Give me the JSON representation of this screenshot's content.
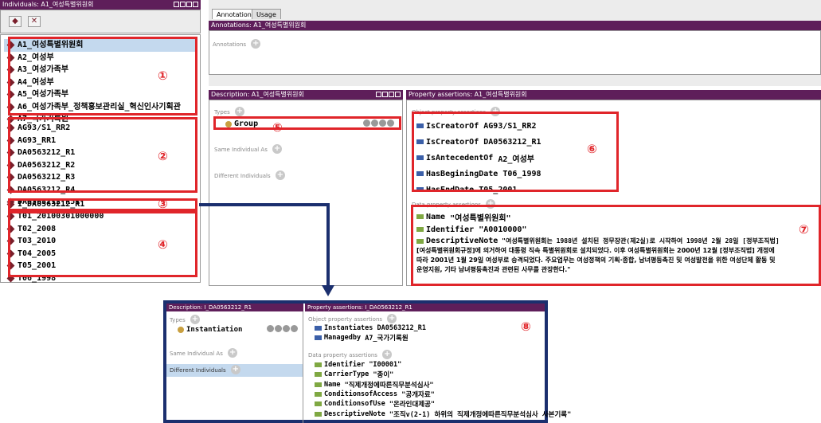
{
  "individuals_panel": {
    "title": "Individuals: A1_여성특별위원회",
    "items_group1": [
      "A1_여성특별위원회",
      "A2_여성부",
      "A3_여성가족부",
      "A4_여성부",
      "A5_여성가족부",
      "A6_여성가족부_정책홍보관리실_혁신인사기획관",
      "A7_국가기록원"
    ],
    "items_group2": [
      "AG93/S1_RR2",
      "AG93_RR1",
      "DA0563212_R1",
      "DA0563212_R2",
      "DA0563212_R3",
      "DA0563212_R4",
      "DA0563212_R51"
    ],
    "items_group3": [
      "I_DA0563212_R1"
    ],
    "items_group4": [
      "T01_20100301000000",
      "T02_2008",
      "T03_2010",
      "T04_2005",
      "T05_2001",
      "T06_1998"
    ],
    "toolbar": {
      "add_icon": "add-individual-icon",
      "delete_icon": "delete-individual-icon"
    }
  },
  "tabs": [
    "Annotations",
    "Usage"
  ],
  "annotations_panel": {
    "title": "Annotations: A1_여성특별위원회",
    "label": "Annotations"
  },
  "description_panel": {
    "title": "Description: A1_여성특별위원회",
    "types_label": "Types",
    "type_value": "Group",
    "same_label": "Same Individual As",
    "different_label": "Different Individuals"
  },
  "property_panel": {
    "title": "Property assertions: A1_여성특별위원회",
    "object_label": "Object property assertions",
    "object_props": [
      {
        "name": "IsCreatorOf",
        "value": "AG93/S1_RR2"
      },
      {
        "name": "IsCreatorOf",
        "value": "DA0563212_R1"
      },
      {
        "name": "IsAntecedentOf",
        "value": "A2_여성부"
      },
      {
        "name": "HasBeginingDate",
        "value": "T06_1998"
      },
      {
        "name": "HasEndDate",
        "value": "T05_2001"
      }
    ],
    "data_label": "Data property assertions",
    "data_props": [
      {
        "name": "Name",
        "value": "\"여성특별위원회\""
      },
      {
        "name": "Identifier",
        "value": "\"A0010000\""
      }
    ],
    "note_name": "DescriptiveNote",
    "note_value": "\"여성특별위원회는 1988년 설치된 정무장관(제2실)로 시작하여 1998년 2월 28일 [정부조직법]",
    "note_lines": [
      "[여성특별위원회규정]에 의거하여 대통령 직속 특별위원회로 설치되었다. 이후 여성특별위원회는 2000년 12월 [정부조직법] 개정에",
      "따라 2001년 1월 29일 여성부로 승격되었다. 주요업무는 여성정책의 기획·종합, 남녀평등촉진 및 여성발전을 위한 여성단체 활동 및",
      "운영지원, 기타 남녀평등촉진과 관련된 사무를 관장한다.\""
    ]
  },
  "bottom_desc": {
    "title": "Description: I_DA0563212_R1",
    "types_label": "Types",
    "type_value": "Instantiation",
    "same_label": "Same Individual As",
    "different_label": "Different Individuals"
  },
  "bottom_props": {
    "title": "Property assertions: I_DA0563212_R1",
    "object_label": "Object property assertions",
    "object_props": [
      {
        "name": "Instantiates",
        "value": "DA0563212_R1"
      },
      {
        "name": "Managedby",
        "value": "A7_국가기록원"
      }
    ],
    "data_label": "Data property assertions",
    "data_props": [
      {
        "name": "Identifier",
        "value": "\"I00001\""
      },
      {
        "name": "CarrierType",
        "value": "\"종이\""
      },
      {
        "name": "Name",
        "value": "\"직제개정에따른직무분석심사\""
      },
      {
        "name": "ConditionsofAccess",
        "value": "\"공개자료\""
      },
      {
        "name": "ConditionsofUse",
        "value": "\"온라인대제공\""
      },
      {
        "name": "DescriptiveNote",
        "value": "\"조직v(2-1) 하위의 직제개정에따른직무분석심사 사본기록\""
      }
    ]
  },
  "callouts": [
    "①",
    "②",
    "③",
    "④",
    "⑤",
    "⑥",
    "⑦",
    "⑧"
  ],
  "colors": {
    "titlebar": "#5e1e5a",
    "highlight": "#e0252a",
    "arrow": "#1b2f6e"
  }
}
